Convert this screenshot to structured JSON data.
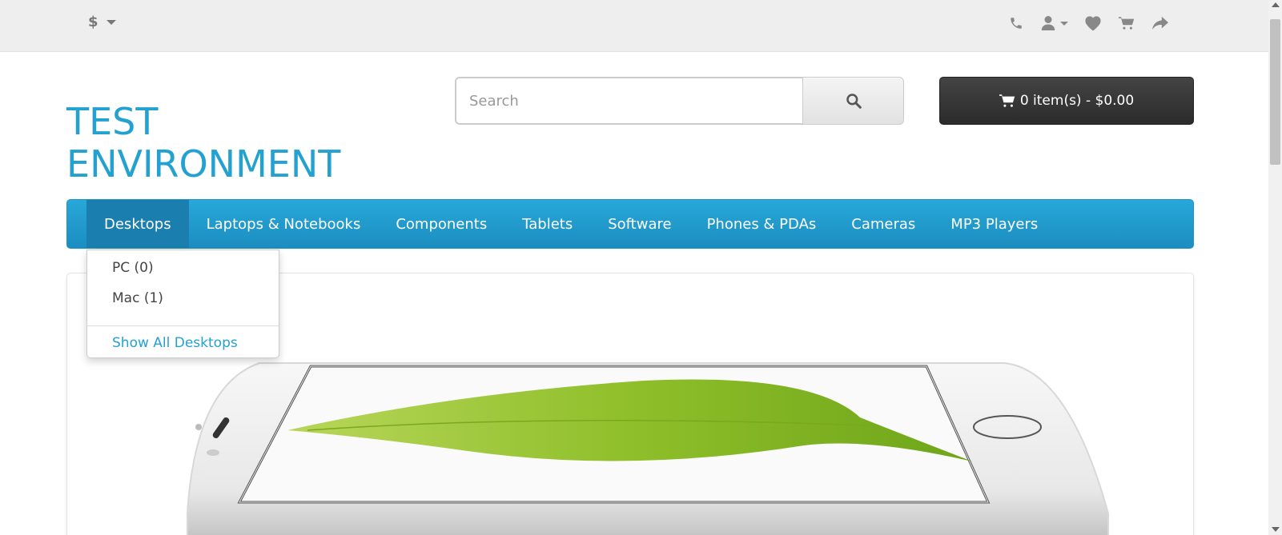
{
  "topbar": {
    "currency_symbol": "$",
    "icons": [
      "phone-icon",
      "user-icon",
      "heart-icon",
      "cart-icon",
      "share-icon"
    ]
  },
  "logo": {
    "line1": "TEST",
    "line2": "ENVIRONMENT"
  },
  "search": {
    "placeholder": "Search"
  },
  "cart": {
    "label": "0 item(s) - $0.00"
  },
  "menu": {
    "items": [
      {
        "label": "Desktops"
      },
      {
        "label": "Laptops & Notebooks"
      },
      {
        "label": "Components"
      },
      {
        "label": "Tablets"
      },
      {
        "label": "Software"
      },
      {
        "label": "Phones & PDAs"
      },
      {
        "label": "Cameras"
      },
      {
        "label": "MP3 Players"
      }
    ]
  },
  "dropdown": {
    "items": [
      {
        "label": "PC (0)"
      },
      {
        "label": "Mac (1)"
      }
    ],
    "show_all": "Show All Desktops"
  },
  "colors": {
    "brand": "#23a1d1",
    "menu_bg": "#229ac8",
    "cart_bg": "#333333"
  }
}
